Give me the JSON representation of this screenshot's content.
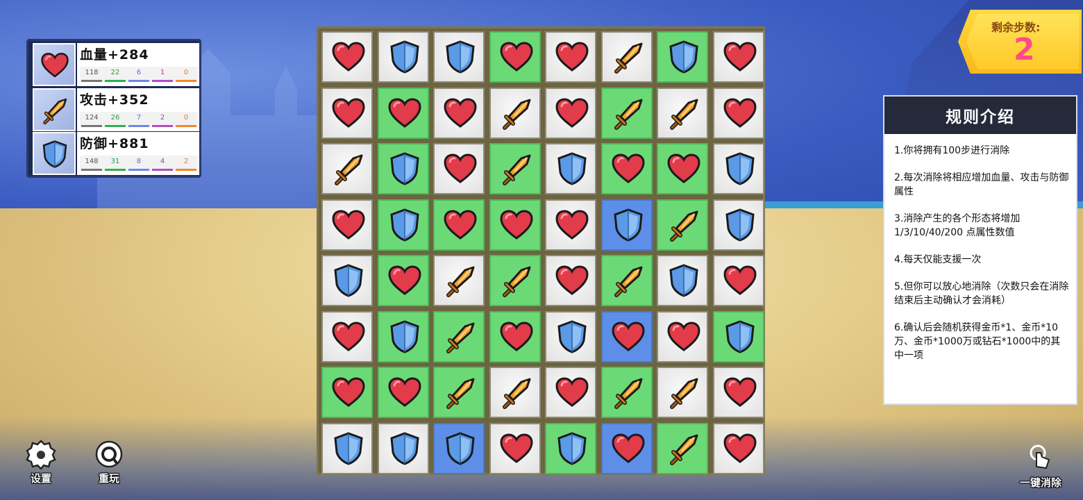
{
  "stats": [
    {
      "icon": "heart",
      "title": "血量+284",
      "nums": [
        "118",
        "22",
        "6",
        "1",
        "0"
      ]
    },
    {
      "icon": "sword",
      "title": "攻击+352",
      "nums": [
        "124",
        "26",
        "7",
        "2",
        "0"
      ]
    },
    {
      "icon": "shield",
      "title": "防御+881",
      "nums": [
        "148",
        "31",
        "8",
        "4",
        "2"
      ]
    }
  ],
  "steps": {
    "label": "剩余步数:",
    "value": "2"
  },
  "rules": {
    "title": "规则介绍",
    "items": [
      "1.你将拥有100步进行消除",
      "2.每次消除将相应增加血量、攻击与防御属性",
      "3.消除产生的各个形态将增加1/3/10/40/200 点属性数值",
      "4.每天仅能支援一次",
      "5.但你可以放心地消除（次数只会在消除结束后主动确认才会消耗）",
      "6.确认后会随机获得金币*1、金币*10万、金币*1000万或钻石*1000中的其中一项"
    ]
  },
  "buttons": {
    "settings": "设置",
    "replay": "重玩",
    "auto_clear": "一键消除"
  },
  "board": {
    "rows": [
      [
        [
          "heart",
          "w"
        ],
        [
          "shield",
          "w"
        ],
        [
          "shield",
          "w"
        ],
        [
          "heart",
          "g"
        ],
        [
          "heart",
          "w"
        ],
        [
          "sword",
          "w"
        ],
        [
          "shield",
          "g"
        ],
        [
          "heart",
          "w"
        ]
      ],
      [
        [
          "heart",
          "w"
        ],
        [
          "heart",
          "g"
        ],
        [
          "heart",
          "w"
        ],
        [
          "sword",
          "w"
        ],
        [
          "heart",
          "w"
        ],
        [
          "sword",
          "g"
        ],
        [
          "sword",
          "w"
        ],
        [
          "heart",
          "w"
        ]
      ],
      [
        [
          "sword",
          "w"
        ],
        [
          "shield",
          "g"
        ],
        [
          "heart",
          "w"
        ],
        [
          "sword",
          "g"
        ],
        [
          "shield",
          "w"
        ],
        [
          "heart",
          "g"
        ],
        [
          "heart",
          "g"
        ],
        [
          "shield",
          "w"
        ]
      ],
      [
        [
          "heart",
          "w"
        ],
        [
          "shield",
          "g"
        ],
        [
          "heart",
          "g"
        ],
        [
          "heart",
          "g"
        ],
        [
          "heart",
          "w"
        ],
        [
          "shield",
          "b"
        ],
        [
          "sword",
          "g"
        ],
        [
          "shield",
          "w"
        ]
      ],
      [
        [
          "shield",
          "w"
        ],
        [
          "heart",
          "g"
        ],
        [
          "sword",
          "w"
        ],
        [
          "sword",
          "g"
        ],
        [
          "heart",
          "w"
        ],
        [
          "sword",
          "g"
        ],
        [
          "shield",
          "w"
        ],
        [
          "heart",
          "w"
        ]
      ],
      [
        [
          "heart",
          "w"
        ],
        [
          "shield",
          "g"
        ],
        [
          "sword",
          "g"
        ],
        [
          "heart",
          "g"
        ],
        [
          "shield",
          "w"
        ],
        [
          "heart",
          "b"
        ],
        [
          "heart",
          "w"
        ],
        [
          "shield",
          "g"
        ]
      ],
      [
        [
          "heart",
          "g"
        ],
        [
          "heart",
          "g"
        ],
        [
          "sword",
          "g"
        ],
        [
          "sword",
          "w"
        ],
        [
          "heart",
          "w"
        ],
        [
          "sword",
          "g"
        ],
        [
          "sword",
          "w"
        ],
        [
          "heart",
          "w"
        ]
      ],
      [
        [
          "shield",
          "w"
        ],
        [
          "shield",
          "w"
        ],
        [
          "shield",
          "b"
        ],
        [
          "heart",
          "w"
        ],
        [
          "shield",
          "g"
        ],
        [
          "heart",
          "b"
        ],
        [
          "sword",
          "g"
        ],
        [
          "heart",
          "w"
        ]
      ]
    ]
  },
  "colors": {
    "tile_white": "#e9e9e9",
    "tile_green": "#6cd977",
    "tile_blue": "#5d8fe8",
    "heart": "#e23b4a",
    "shield": "#5a9ae6",
    "sword": "#f0a030",
    "steps_value": "#ff4a8a"
  }
}
